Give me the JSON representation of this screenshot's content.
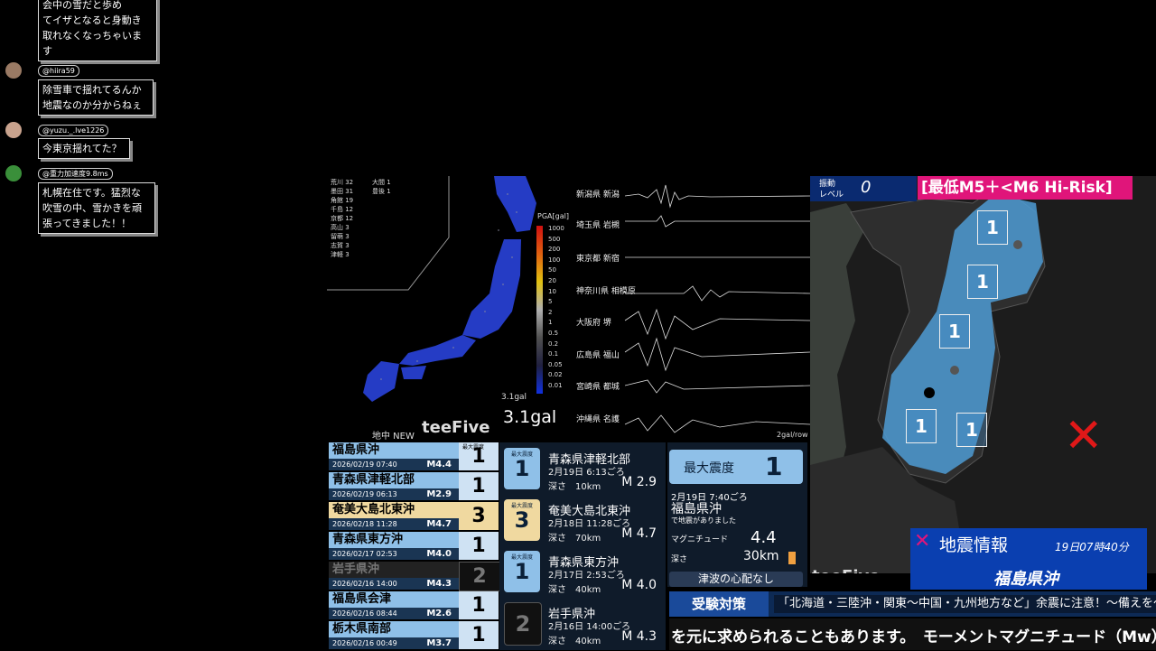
{
  "chat": [
    {
      "user": "",
      "message_lines": [
        "会中の雪だと歩め",
        "てイザとなると身動き",
        "取れなくなっちゃいま",
        "す"
      ]
    },
    {
      "user": "@hiira59",
      "message_lines": [
        "除雪車で揺れてるんか",
        "地震なのか分からねぇ"
      ]
    },
    {
      "user": "@yuzu._.lve1226",
      "message_lines": [
        "今東京揺れてた？"
      ]
    },
    {
      "user": "@重力加速度9.8ms",
      "message_lines": [
        "札幌在住です。猛烈な",
        "吹雪の中、雪かきを頑",
        "張ってきました！！"
      ]
    }
  ],
  "map_panel": {
    "station_counts_left": [
      "荒川 32",
      "墨田 31",
      "角館 19",
      "千島 12",
      "京都 12",
      "高山 3",
      "留萌 3",
      "志賀 3",
      "津軽 3"
    ],
    "station_counts_right": [
      "大間 1",
      "豊後 1"
    ],
    "scale_title": "PGA[gal]",
    "scale_ticks": [
      "1000",
      "500",
      "200",
      "100",
      "50",
      "20",
      "10",
      "5",
      "2",
      "1",
      "0.5",
      "0.2",
      "0.1",
      "0.05",
      "0.02",
      "0.01"
    ],
    "pga_small": "3.1gal",
    "pga_large": "3.1gal",
    "layer_label": "地中 NEW",
    "brand": "teeFive"
  },
  "waves": {
    "stations": [
      "新潟県 新潟",
      "埼玉県 岩槻",
      "東京都 新宿",
      "神奈川県 相模原",
      "大阪府 堺",
      "広島県 福山",
      "宮崎県 都城",
      "沖縄県 名護"
    ],
    "scale_note": "2gal/row"
  },
  "right_map": {
    "vib_label_1": "振動",
    "vib_label_2": "レベル",
    "vib_value": "0",
    "risk_banner": "[最低M5＋<M6 Hi-Risk]",
    "intensities": [
      "1",
      "1",
      "1",
      "1",
      "1"
    ],
    "brand": "teeFive",
    "info_title": "地震情報",
    "info_time": "19日07時40分",
    "info_region": "福島県沖"
  },
  "history": [
    {
      "location": "福島県沖",
      "datetime": "2026/02/19 07:40",
      "magnitude": "M4.4",
      "intensity": "1",
      "header": "最大震度"
    },
    {
      "location": "青森県津軽北部",
      "datetime": "2026/02/19 06:13",
      "magnitude": "M2.9",
      "intensity": "1"
    },
    {
      "location": "奄美大島北東沖",
      "datetime": "2026/02/18 11:28",
      "magnitude": "M4.7",
      "intensity": "3"
    },
    {
      "location": "青森県東方沖",
      "datetime": "2026/02/17 02:53",
      "magnitude": "M4.0",
      "intensity": "1"
    },
    {
      "location": "岩手県沖",
      "datetime": "2026/02/16 14:00",
      "magnitude": "M4.3",
      "intensity": "2"
    },
    {
      "location": "福島県会津",
      "datetime": "2026/02/16 08:44",
      "magnitude": "M2.6",
      "intensity": "1"
    },
    {
      "location": "栃木県南部",
      "datetime": "2026/02/16 00:49",
      "magnitude": "M3.7",
      "intensity": "1"
    }
  ],
  "cards": [
    {
      "cap": "最大震度",
      "intensity": "1",
      "location": "青森県津軽北部",
      "datetime": "2月19日 6:13ごろ",
      "depth": "深さ　10km",
      "magnitude": "M 2.9"
    },
    {
      "cap": "最大震度",
      "intensity": "3",
      "location": "奄美大島北東沖",
      "datetime": "2月18日 11:28ごろ",
      "depth": "深さ　70km",
      "magnitude": "M 4.7"
    },
    {
      "cap": "最大震度",
      "intensity": "1",
      "location": "青森県東方沖",
      "datetime": "2月17日 2:53ごろ",
      "depth": "深さ　40km",
      "magnitude": "M 4.0"
    },
    {
      "cap": "",
      "intensity": "2",
      "location": "岩手県沖",
      "datetime": "2月16日 14:00ごろ",
      "depth": "深さ　40km",
      "magnitude": "M 4.3"
    }
  ],
  "summary": {
    "max_label": "最大震度",
    "max_value": "1",
    "datetime": "2月19日 7:40ごろ",
    "region": "福島県沖",
    "sub": "で地震がありました",
    "mag_label": "マグニチュード",
    "mag_value": "4.4",
    "depth_label": "深さ",
    "depth_value": "30km",
    "tsunami": "津波の心配なし"
  },
  "ticker1": {
    "tag": "受験対策",
    "text": "「北海道・三陸沖・関東～中国・九州地方など」余震に注意！～備えを～"
  },
  "ticker2": {
    "text": "を元に求められることもあります。　モーメントマグニチュード（Mw）"
  },
  "colors": {
    "accent_blue": "#8fc0e8",
    "panel": "#0f1b2a",
    "risk_pink": "#e0157a",
    "ticker_blue": "#0d2a55"
  }
}
